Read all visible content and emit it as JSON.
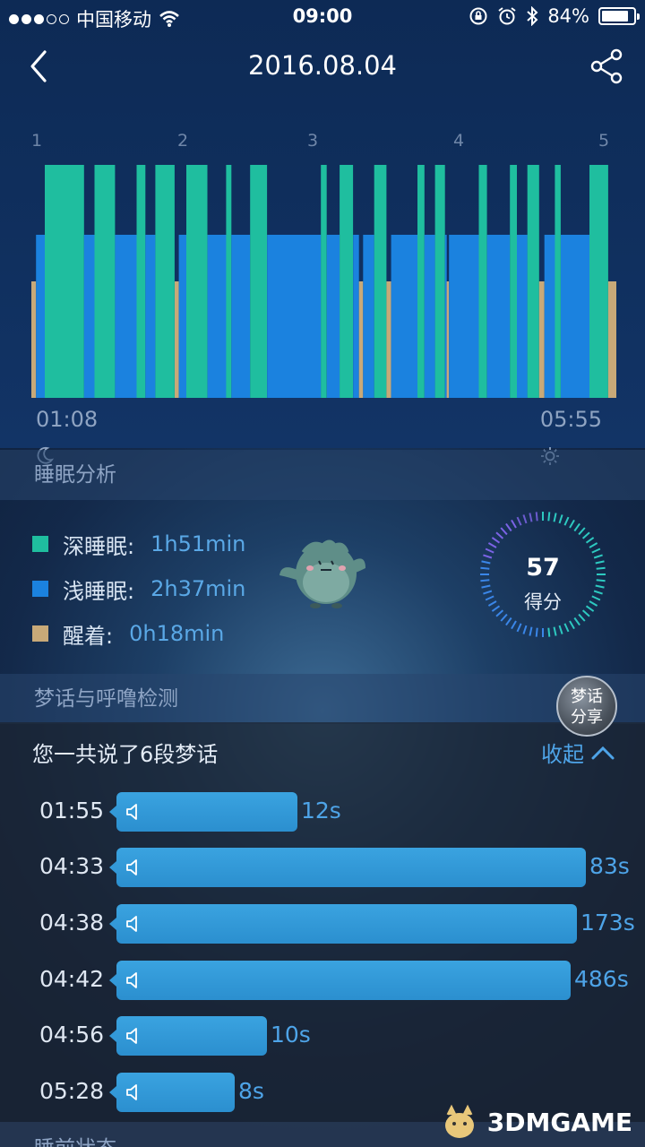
{
  "status_bar": {
    "carrier": "中国移动",
    "time": "09:00",
    "battery": "84%",
    "battery_level": 0.84
  },
  "nav": {
    "title": "2016.08.04",
    "back_icon": "chevron-left-icon",
    "share_icon": "share-icon"
  },
  "sleep_chart": {
    "hour_labels": [
      "1",
      "2",
      "3",
      "4",
      "5"
    ],
    "start_time": "01:08",
    "end_time": "05:55",
    "colors": {
      "deep": "#1fbe9f",
      "light": "#1b82df",
      "awake": "#c8a978"
    },
    "levels": {
      "deep": 1.0,
      "light": 0.7,
      "awake": 0.5
    },
    "segments": [
      {
        "s": "awake",
        "start": 0.0,
        "end": 0.008
      },
      {
        "s": "light",
        "start": 0.008,
        "end": 0.023
      },
      {
        "s": "deep",
        "start": 0.023,
        "end": 0.09
      },
      {
        "s": "light",
        "start": 0.09,
        "end": 0.108
      },
      {
        "s": "deep",
        "start": 0.108,
        "end": 0.143
      },
      {
        "s": "light",
        "start": 0.143,
        "end": 0.18
      },
      {
        "s": "deep",
        "start": 0.18,
        "end": 0.195
      },
      {
        "s": "light",
        "start": 0.195,
        "end": 0.212
      },
      {
        "s": "deep",
        "start": 0.212,
        "end": 0.245
      },
      {
        "s": "awake",
        "start": 0.245,
        "end": 0.252
      },
      {
        "s": "light",
        "start": 0.252,
        "end": 0.265
      },
      {
        "s": "deep",
        "start": 0.265,
        "end": 0.301
      },
      {
        "s": "light",
        "start": 0.301,
        "end": 0.333
      },
      {
        "s": "deep",
        "start": 0.333,
        "end": 0.342
      },
      {
        "s": "light",
        "start": 0.342,
        "end": 0.374
      },
      {
        "s": "deep",
        "start": 0.374,
        "end": 0.403
      },
      {
        "s": "light",
        "start": 0.403,
        "end": 0.495
      },
      {
        "s": "deep",
        "start": 0.495,
        "end": 0.505
      },
      {
        "s": "light",
        "start": 0.505,
        "end": 0.527
      },
      {
        "s": "deep",
        "start": 0.527,
        "end": 0.55
      },
      {
        "s": "light",
        "start": 0.55,
        "end": 0.56
      },
      {
        "s": "awake",
        "start": 0.56,
        "end": 0.567
      },
      {
        "s": "light",
        "start": 0.567,
        "end": 0.586
      },
      {
        "s": "deep",
        "start": 0.586,
        "end": 0.607
      },
      {
        "s": "awake",
        "start": 0.607,
        "end": 0.615
      },
      {
        "s": "light",
        "start": 0.615,
        "end": 0.66
      },
      {
        "s": "deep",
        "start": 0.66,
        "end": 0.672
      },
      {
        "s": "light",
        "start": 0.672,
        "end": 0.69
      },
      {
        "s": "deep",
        "start": 0.69,
        "end": 0.707
      },
      {
        "s": "light",
        "start": 0.707,
        "end": 0.71
      },
      {
        "s": "awake",
        "start": 0.71,
        "end": 0.714
      },
      {
        "s": "light",
        "start": 0.714,
        "end": 0.765
      },
      {
        "s": "deep",
        "start": 0.765,
        "end": 0.779
      },
      {
        "s": "light",
        "start": 0.779,
        "end": 0.818
      },
      {
        "s": "deep",
        "start": 0.818,
        "end": 0.83
      },
      {
        "s": "light",
        "start": 0.83,
        "end": 0.848
      },
      {
        "s": "deep",
        "start": 0.848,
        "end": 0.868
      },
      {
        "s": "awake",
        "start": 0.868,
        "end": 0.877
      },
      {
        "s": "light",
        "start": 0.877,
        "end": 0.895
      },
      {
        "s": "deep",
        "start": 0.895,
        "end": 0.905
      },
      {
        "s": "light",
        "start": 0.905,
        "end": 0.954
      },
      {
        "s": "deep",
        "start": 0.954,
        "end": 0.986
      },
      {
        "s": "awake",
        "start": 0.986,
        "end": 1.0
      }
    ]
  },
  "analysis": {
    "header": "睡眠分析",
    "legend": [
      {
        "label": "深睡眠:",
        "value": "1h51min",
        "color": "#1fbe9f"
      },
      {
        "label": "浅睡眠:",
        "value": "2h37min",
        "color": "#1b82df"
      },
      {
        "label": "醒着:",
        "value": "0h18min",
        "color": "#c8a978"
      }
    ],
    "score": "57",
    "score_value": 57,
    "score_label": "得分"
  },
  "dream": {
    "header": "梦话与呼噜检测",
    "share_line1": "梦话",
    "share_line2": "分享",
    "count_text": "您一共说了6段梦话",
    "collapse_label": "收起",
    "recordings": [
      {
        "time": "01:55",
        "duration": "12s"
      },
      {
        "time": "04:33",
        "duration": "83s"
      },
      {
        "time": "04:38",
        "duration": "173s"
      },
      {
        "time": "04:42",
        "duration": "486s"
      },
      {
        "time": "04:56",
        "duration": "10s"
      },
      {
        "time": "05:28",
        "duration": "8s"
      }
    ]
  },
  "footer": {
    "header": "睡前状态"
  },
  "watermark": {
    "text": "3DMGAME"
  }
}
